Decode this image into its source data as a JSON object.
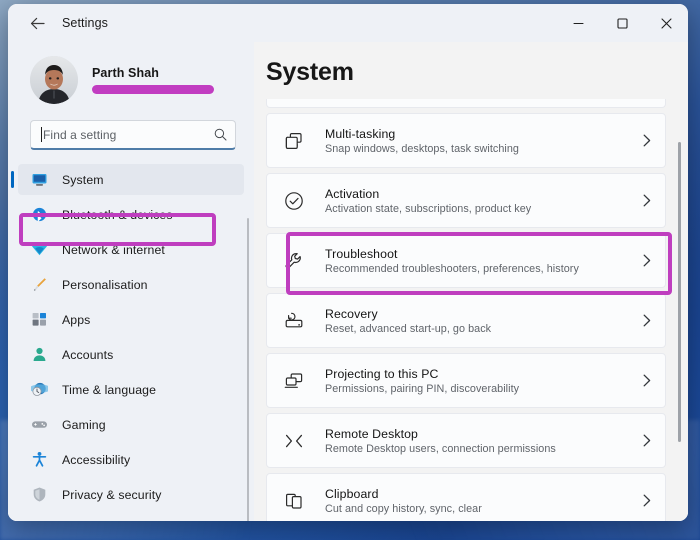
{
  "window": {
    "title": "Settings",
    "back_icon": "back-arrow-icon",
    "minimize_label": "—",
    "maximize_label": "□",
    "close_label": "✕"
  },
  "account": {
    "name": "Parth Shah",
    "email_redacted": true,
    "avatar_icon": "user-avatar-photo"
  },
  "search": {
    "placeholder": "Find a setting",
    "icon": "search-icon"
  },
  "sidebar": {
    "items": [
      {
        "label": "System",
        "icon": "monitor-icon",
        "selected": true
      },
      {
        "label": "Bluetooth & devices",
        "icon": "bluetooth-icon",
        "selected": false
      },
      {
        "label": "Network & internet",
        "icon": "wifi-icon",
        "selected": false
      },
      {
        "label": "Personalisation",
        "icon": "paintbrush-icon",
        "selected": false
      },
      {
        "label": "Apps",
        "icon": "apps-grid-icon",
        "selected": false
      },
      {
        "label": "Accounts",
        "icon": "person-icon",
        "selected": false
      },
      {
        "label": "Time & language",
        "icon": "clock-globe-icon",
        "selected": false
      },
      {
        "label": "Gaming",
        "icon": "gamepad-icon",
        "selected": false
      },
      {
        "label": "Accessibility",
        "icon": "accessibility-icon",
        "selected": false
      },
      {
        "label": "Privacy & security",
        "icon": "shield-icon",
        "selected": false
      }
    ]
  },
  "main": {
    "page_title": "System",
    "items": [
      {
        "title": "Multi-tasking",
        "subtitle": "Snap windows, desktops, task switching",
        "icon": "windows-stack-icon",
        "highlighted": false
      },
      {
        "title": "Activation",
        "subtitle": "Activation state, subscriptions, product key",
        "icon": "check-circle-icon",
        "highlighted": false
      },
      {
        "title": "Troubleshoot",
        "subtitle": "Recommended troubleshooters, preferences, history",
        "icon": "wrench-icon",
        "highlighted": true
      },
      {
        "title": "Recovery",
        "subtitle": "Reset, advanced start-up, go back",
        "icon": "recovery-pc-icon",
        "highlighted": false
      },
      {
        "title": "Projecting to this PC",
        "subtitle": "Permissions, pairing PIN, discoverability",
        "icon": "project-screen-icon",
        "highlighted": false
      },
      {
        "title": "Remote Desktop",
        "subtitle": "Remote Desktop users, connection permissions",
        "icon": "remote-arrows-icon",
        "highlighted": false
      },
      {
        "title": "Clipboard",
        "subtitle": "Cut and copy history, sync, clear",
        "icon": "clipboard-icon",
        "highlighted": false
      }
    ]
  },
  "colors": {
    "annotation": "#bf3ebf",
    "accent": "#0067c0",
    "window_bg": "#f3f3f3",
    "sidebar_bg": "#eef1f6"
  }
}
